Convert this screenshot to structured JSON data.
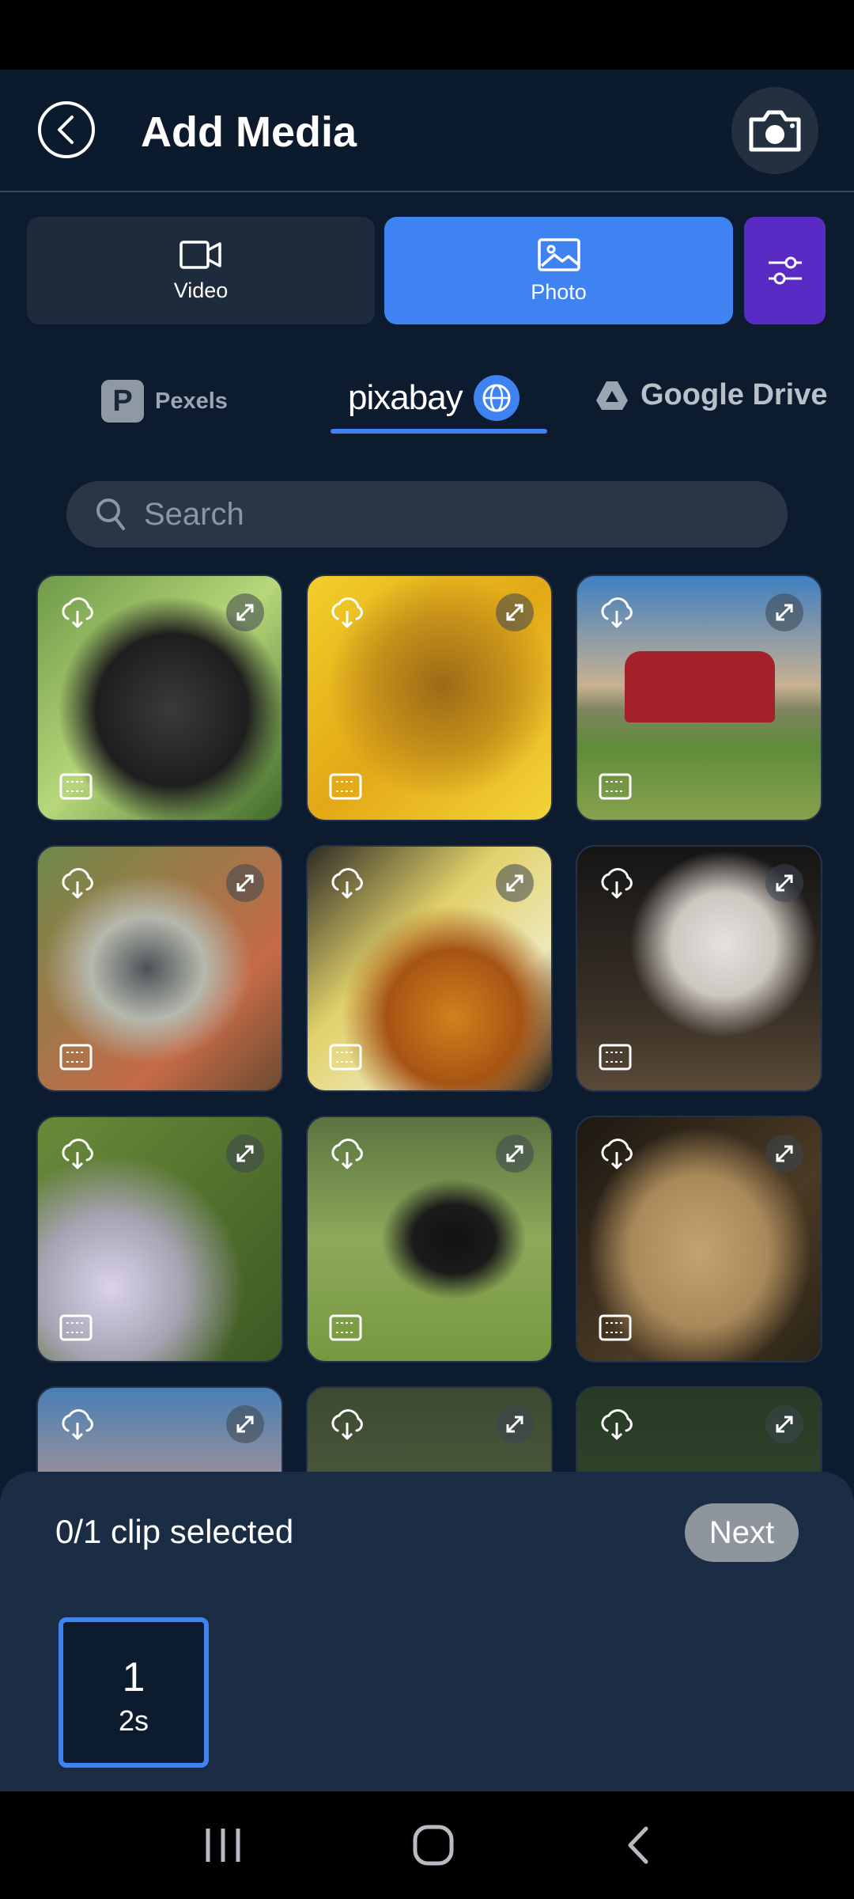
{
  "header": {
    "title": "Add Media"
  },
  "media_tabs": [
    {
      "label": "Video",
      "icon": "video-camera-icon",
      "active": false
    },
    {
      "label": "Photo",
      "icon": "image-icon",
      "active": true
    }
  ],
  "source_tabs": {
    "pexels": "Pexels",
    "pixabay": "pixabay",
    "google_drive": "Google Drive",
    "active": "pixabay"
  },
  "search": {
    "placeholder": "Search"
  },
  "photos": [
    {
      "subject": "monkey"
    },
    {
      "subject": "sunflower"
    },
    {
      "subject": "tractor"
    },
    {
      "subject": "bird"
    },
    {
      "subject": "bee on flower"
    },
    {
      "subject": "vulture"
    },
    {
      "subject": "flowers"
    },
    {
      "subject": "crow"
    },
    {
      "subject": "meerkat"
    },
    {
      "subject": "tractor"
    },
    {
      "subject": "animal"
    },
    {
      "subject": "animal"
    }
  ],
  "selection": {
    "status": "0/1 clip selected",
    "next_label": "Next",
    "clips": [
      {
        "number": "1",
        "duration": "2s"
      }
    ]
  },
  "colors": {
    "background": "#0d1b2e",
    "accent": "#3f83f2",
    "filter": "#5a2bc4",
    "panel": "#1a2d45"
  }
}
